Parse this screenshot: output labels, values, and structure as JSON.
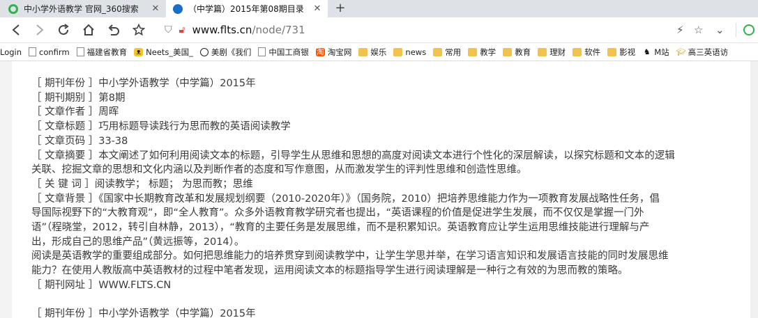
{
  "tabs": [
    {
      "title": "中小学外语教学 官网_360搜索",
      "favicon": "360-logo-icon"
    },
    {
      "title": "（中学篇）2015年第08期目录",
      "favicon": "drupal-drop-icon",
      "active": true
    }
  ],
  "new_tab_label": "+",
  "address": {
    "host": "www.flts.cn",
    "path": "/node/731"
  },
  "bookmarks": [
    {
      "label": "Login",
      "icon": "none"
    },
    {
      "label": "confirm",
      "icon": "page"
    },
    {
      "label": "福建省教育",
      "icon": "page"
    },
    {
      "label": "Neets_美国_",
      "icon": "cat"
    },
    {
      "label": "美剧《我们",
      "icon": "circle"
    },
    {
      "label": "中国工商银",
      "icon": "page"
    },
    {
      "label": "淘宝网",
      "icon": "taobao"
    },
    {
      "label": "娱乐",
      "icon": "folder"
    },
    {
      "label": "news",
      "icon": "folder"
    },
    {
      "label": "常用",
      "icon": "folder"
    },
    {
      "label": "教学",
      "icon": "folder"
    },
    {
      "label": "教育",
      "icon": "folder"
    },
    {
      "label": "理财",
      "icon": "folder"
    },
    {
      "label": "软件",
      "icon": "folder"
    },
    {
      "label": "影视",
      "icon": "folder"
    },
    {
      "label": "M站",
      "icon": "m"
    },
    {
      "label": "高三英语访",
      "icon": "grad"
    }
  ],
  "article": {
    "year": "［ 期刊年份 ］中小学外语教学（中学篇）2015年",
    "issue": "［ 期刊期别 ］第8期",
    "author": "［ 文章作者 ］周晖",
    "title": "［ 文章标题 ］巧用标题导读践行为思而教的英语阅读教学",
    "pages": "［ 文章页码 ］33-38",
    "abstract_1": "［ 文章摘要 ］本文阐述了如何利用阅读文本的标题，引导学生从思维和思想的高度对阅读文本进行个性化的深层解读，以探究标题和文本的逻辑",
    "abstract_2": "关联、挖掘文章的思想和文化内涵以及判断作者的态度和写作意图，从而激发学生的评判性思维和创造性思维。",
    "keywords": "［ 关 键 词 ］阅读教学； 标题； 为思而教；思维",
    "bg_1": "［ 文章背景 ］《国家中长期教育改革和发展规划纲要（2010-2020年）》（国务院，2010）把培养思维能力作为一项教育发展战略性任务，倡",
    "bg_2": "导国际视野下的“大教育观”，即“全人教育”。众多外语教育教学研究者也提出，“英语课程的价值是促进学生发展，而不仅仅是掌握一门外",
    "bg_3": "语”（程晓堂，2012，转引自林静，2013），“教育的主要任务是发展思维，而不是积累知识。英语教育应让学生运用思维技能进行理解与产",
    "bg_4": "出，形成自己的思维产品”（黄远振等，2014）。",
    "body_1": "阅读是英语教学的重要组成部分。如何把思维能力的培养贯穿到阅读教学中，让学生学思并举，在学习语言知识和发展语言技能的同时发展思维",
    "body_2": "能力？在使用人教版高中英语教材的过程中笔者发现，运用阅读文本的标题指导学生进行阅读理解是一种行之有效的为思而教的策略。",
    "url": "［ 期刊网址 ］WWW.FLTS.CN",
    "next_year": "［ 期刊年份 ］中小学外语教学（中学篇）2015年"
  }
}
